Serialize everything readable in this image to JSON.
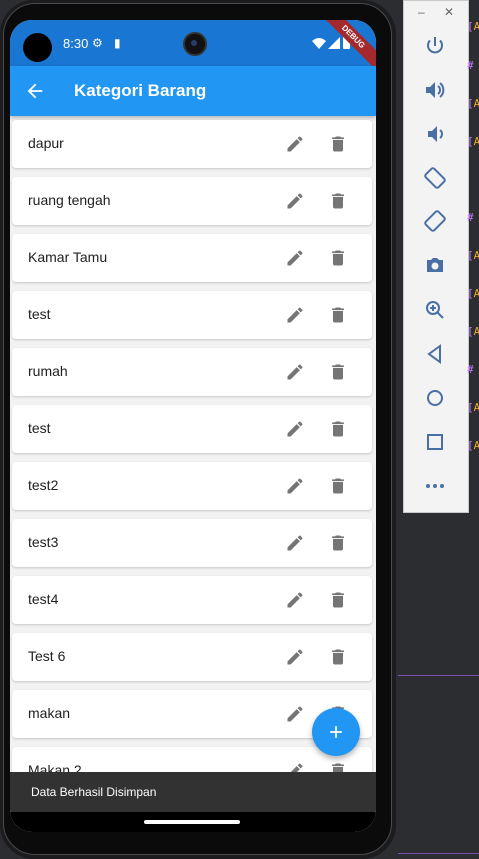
{
  "status": {
    "time": "8:30",
    "debug": "DEBUG"
  },
  "appbar": {
    "title": "Kategori Barang"
  },
  "categories": [
    {
      "name": "dapur"
    },
    {
      "name": "ruang tengah"
    },
    {
      "name": "Kamar Tamu"
    },
    {
      "name": "test"
    },
    {
      "name": "rumah"
    },
    {
      "name": "test"
    },
    {
      "name": "test2"
    },
    {
      "name": "test3"
    },
    {
      "name": "test4"
    },
    {
      "name": "Test 6"
    },
    {
      "name": "makan"
    },
    {
      "name": "Makan 2"
    }
  ],
  "snackbar": {
    "message": "Data Berhasil Disimpan"
  },
  "emulator": {
    "window_min": "–",
    "window_close": "✕",
    "buttons": [
      "power-icon",
      "volume-up-icon",
      "volume-down-icon",
      "rotate-left-icon",
      "rotate-right-icon",
      "camera-icon",
      "zoom-icon",
      "back-icon",
      "home-icon",
      "overview-icon",
      "more-icon"
    ]
  },
  "colors": {
    "primary": "#2196f3",
    "status_bar": "#1976d2",
    "background": "#f2f2f2",
    "icon": "#757575"
  }
}
